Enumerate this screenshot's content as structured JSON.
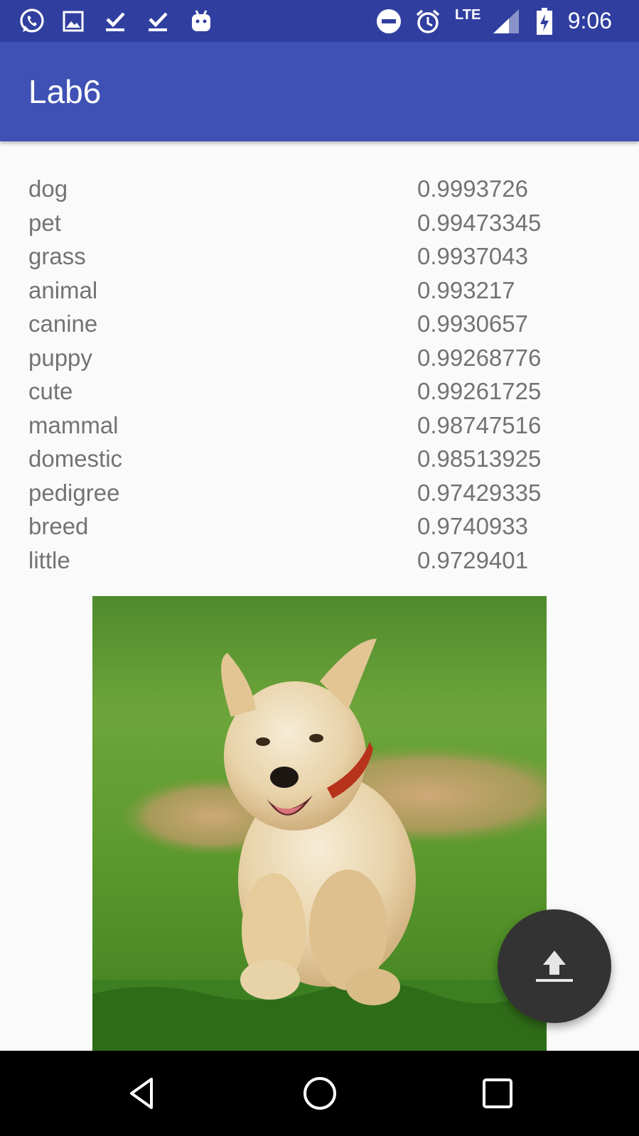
{
  "status_bar": {
    "time": "9:06",
    "network": "LTE",
    "left_icons": [
      "whatsapp-icon",
      "image-icon",
      "download-done-icon",
      "download-done-icon",
      "android-icon"
    ],
    "right_icons": [
      "do-not-disturb-icon",
      "alarm-icon",
      "signal-icon",
      "battery-charging-icon"
    ]
  },
  "app_bar": {
    "title": "Lab6",
    "color": "#3f51b5",
    "status_color": "#303f9f"
  },
  "labels": [
    {
      "name": "dog",
      "score": "0.9993726"
    },
    {
      "name": "pet",
      "score": "0.99473345"
    },
    {
      "name": "grass",
      "score": "0.9937043"
    },
    {
      "name": "animal",
      "score": "0.993217"
    },
    {
      "name": "canine",
      "score": "0.9930657"
    },
    {
      "name": "puppy",
      "score": "0.99268776"
    },
    {
      "name": "cute",
      "score": "0.99261725"
    },
    {
      "name": "mammal",
      "score": "0.98747516"
    },
    {
      "name": "domestic",
      "score": "0.98513925"
    },
    {
      "name": "pedigree",
      "score": "0.97429335"
    },
    {
      "name": "breed",
      "score": "0.9740933"
    },
    {
      "name": "little",
      "score": "0.9729401"
    }
  ],
  "fab": {
    "icon": "upload-icon",
    "color": "#333333"
  },
  "nav_bar": {
    "icons": [
      "back-icon",
      "home-icon",
      "recents-icon"
    ]
  }
}
